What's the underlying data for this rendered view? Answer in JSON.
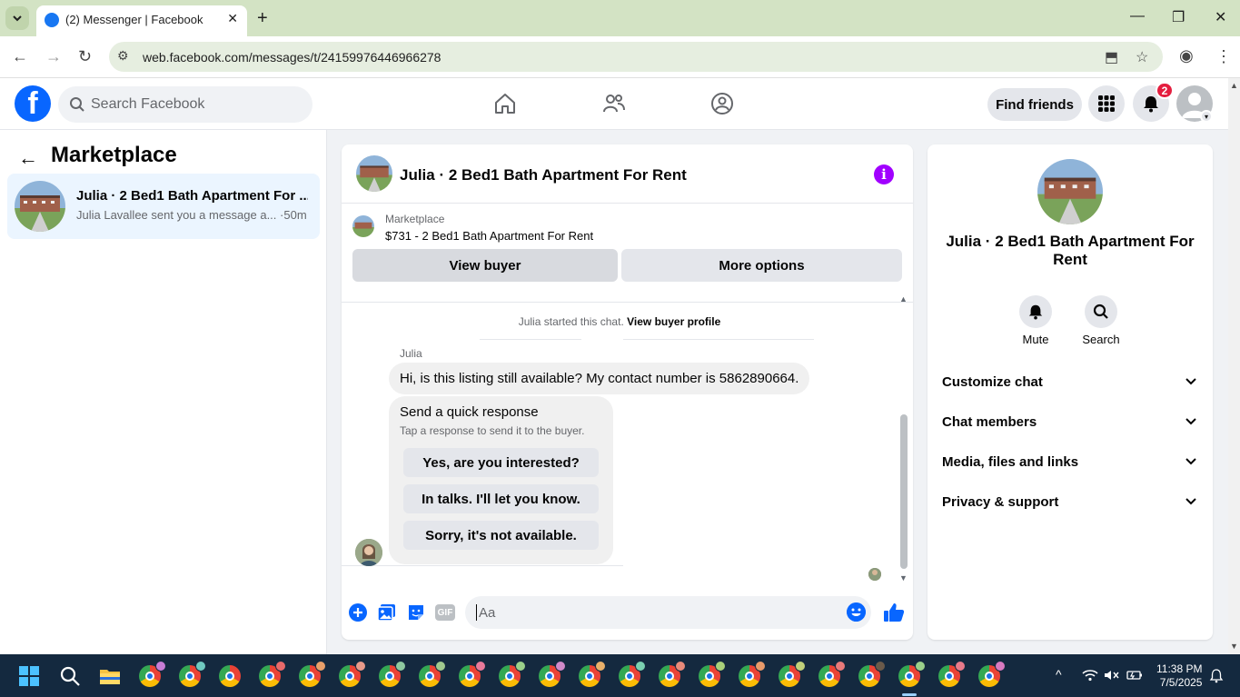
{
  "browser": {
    "tab_title": "(2) Messenger | Facebook",
    "url": "web.facebook.com/messages/t/24159976446966278"
  },
  "header": {
    "search_placeholder": "Search Facebook",
    "find_friends_label": "Find friends",
    "notification_count": "2",
    "logo_letter": "f"
  },
  "sidebar": {
    "title": "Marketplace",
    "conversations": [
      {
        "name": "Julia · 2 Bed1 Bath Apartment For ...",
        "snippet": "Julia Lavallee sent you a message a...",
        "time": "·50m"
      }
    ]
  },
  "chat": {
    "title": "Julia · 2 Bed1 Bath Apartment For Rent",
    "marketplace_label": "Marketplace",
    "listing": "$731 - 2 Bed1 Bath Apartment For Rent",
    "view_buyer_label": "View buyer",
    "more_options_label": "More options",
    "started_text": "Julia started this chat.",
    "view_buyer_profile_label": "View buyer profile",
    "sender_name": "Julia",
    "message": "Hi, is this listing still available? My contact number is 5862890664.",
    "quick_response": {
      "title": "Send a quick response",
      "subtitle": "Tap a response to send it to the buyer.",
      "options": [
        "Yes, are you interested?",
        "In talks. I'll let you know.",
        "Sorry, it's not available."
      ]
    },
    "composer_placeholder": "Aa",
    "gif_label": "GIF"
  },
  "info_panel": {
    "title": "Julia · 2 Bed1 Bath Apartment For Rent",
    "actions": [
      {
        "label": "Mute",
        "icon": "bell-icon"
      },
      {
        "label": "Search",
        "icon": "search-icon"
      }
    ],
    "sections": [
      "Customize chat",
      "Chat members",
      "Media, files and links",
      "Privacy & support"
    ]
  },
  "taskbar": {
    "time": "11:38 PM",
    "date": "7/5/2025"
  },
  "colors": {
    "facebook_blue": "#0866ff",
    "tab_strip": "#d3e3c4",
    "info_purple": "#a100ff",
    "badge_red": "#e41e3f",
    "taskbar": "#14293f"
  }
}
